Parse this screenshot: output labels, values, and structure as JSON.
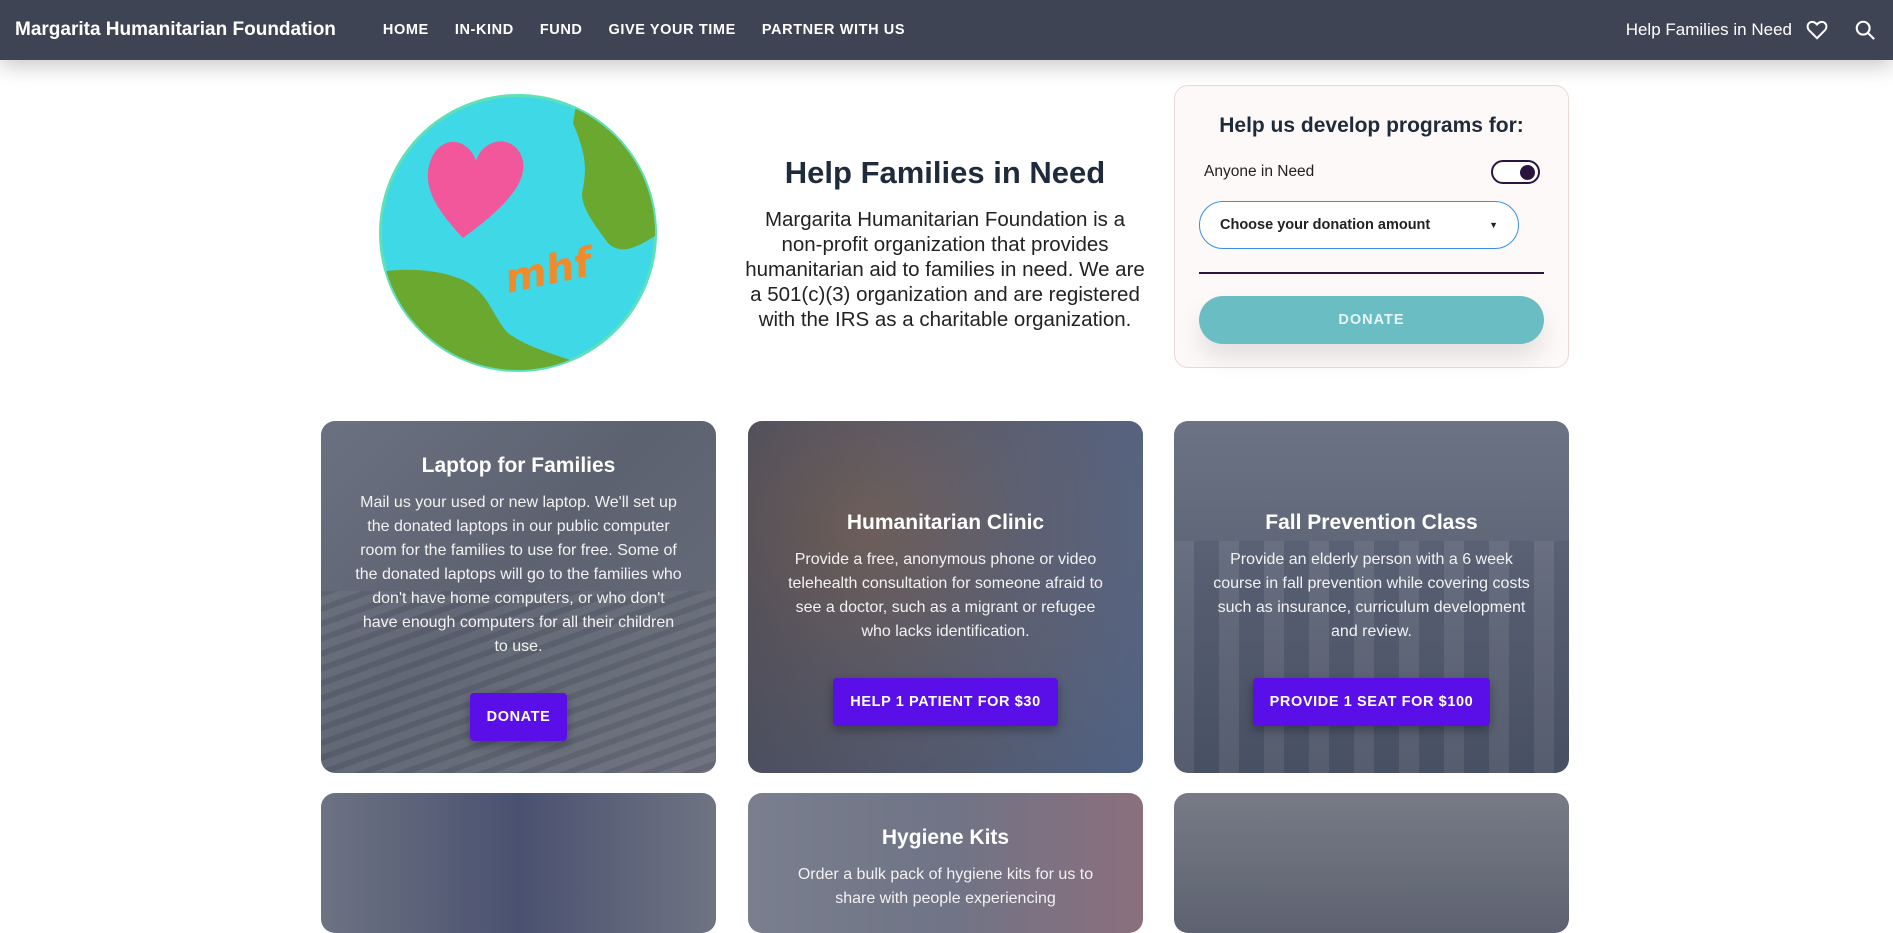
{
  "nav": {
    "brand": "Margarita Humanitarian Foundation",
    "items": [
      {
        "label": "HOME"
      },
      {
        "label": "IN-KIND"
      },
      {
        "label": "FUND"
      },
      {
        "label": "GIVE YOUR TIME"
      },
      {
        "label": "PARTNER WITH US"
      }
    ],
    "right_link": "Help Families in Need",
    "icons": [
      "heart-icon",
      "search-icon"
    ]
  },
  "hero": {
    "logo_text": "mhf",
    "title": "Help Families in Need",
    "description": "Margarita Humanitarian Foundation is a non-profit organization that provides humanitarian aid to families in need. We are a 501(c)(3) organization and are registered with the IRS as a charitable organization."
  },
  "donate_panel": {
    "title": "Help us develop programs for:",
    "toggle_label": "Anyone in Need",
    "toggle_on": true,
    "select_placeholder": "Choose your donation amount",
    "button_label": "DONATE",
    "button_color": "#6bbdc4"
  },
  "cards": [
    {
      "title": "Laptop for Families",
      "description": "Mail us your used or new laptop. We'll set up the donated laptops in our public computer room for the families to use for free. Some of the donated laptops will go to the families who don't have home computers, or who don't have enough computers for all their children to use.",
      "button": "DONATE"
    },
    {
      "title": "Humanitarian Clinic",
      "description": "Provide a free, anonymous phone or video telehealth consultation for someone afraid to see a doctor, such as a migrant or refugee who lacks identification.",
      "button": "HELP 1 PATIENT FOR $30"
    },
    {
      "title": "Fall Prevention Class",
      "description": "Provide an elderly person with a 6 week course in fall prevention while covering costs such as insurance, curriculum development and review.",
      "button": "PROVIDE 1 SEAT FOR $100"
    },
    {
      "title": "",
      "description": "",
      "button": ""
    },
    {
      "title": "Hygiene Kits",
      "description": "Order a bulk pack of hygiene kits for us to share with people experiencing",
      "button": ""
    },
    {
      "title": "",
      "description": "",
      "button": ""
    }
  ],
  "colors": {
    "nav_bg": "#3e4453",
    "card_button": "#5a0fe8",
    "accent_dark": "#2a1440"
  }
}
